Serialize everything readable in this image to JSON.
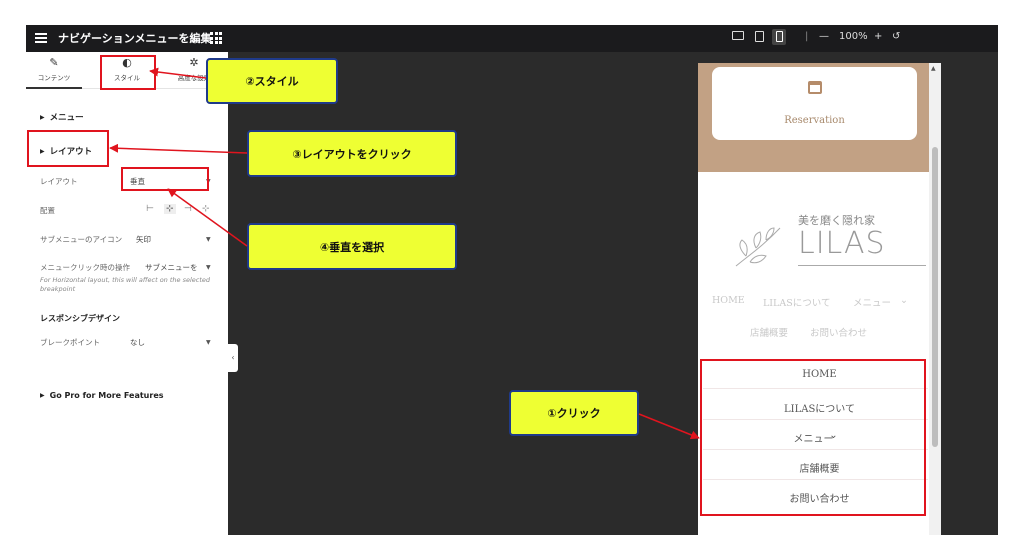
{
  "topbar": {
    "title": "ナビゲーションメニューを編集",
    "zoom": "100%",
    "zoom_minus": "—",
    "zoom_plus": "+",
    "undo": "↺"
  },
  "panel": {
    "tabs": [
      {
        "icon": "✎",
        "label": "コンテンツ"
      },
      {
        "icon": "◐",
        "label": "スタイル"
      },
      {
        "icon": "✲",
        "label": "高度な設定"
      }
    ],
    "menu_section": "メニュー",
    "layout_section": "レイアウト",
    "layout_label": "レイアウト",
    "layout_value": "垂直",
    "align_label": "配置",
    "submenu_icon_label": "サブメニューのアイコン",
    "submenu_icon_value": "矢印",
    "click_action_label": "メニュークリック時の操作",
    "click_action_value": "サブメニューを",
    "note": "For Horizontal layout, this will affect on the selected breakpoint",
    "responsive_heading": "レスポンシブデザイン",
    "breakpoint_label": "ブレークポイント",
    "breakpoint_value": "なし",
    "go_pro": "Go Pro for More Features"
  },
  "preview": {
    "reservation": "Reservation",
    "logo_sub": "美を磨く隠れ家",
    "logo_main": "LILAS",
    "hnav": [
      "HOME",
      "LILASについて",
      "メニュー",
      "店舗概要",
      "お問い合わせ"
    ],
    "vmenu": [
      "HOME",
      "LILASについて",
      "メニュー",
      "店舗概要",
      "お問い合わせ"
    ]
  },
  "callouts": {
    "style": "②スタイル",
    "layout_click": "③レイアウトをクリック",
    "vertical_select": "④垂直を選択",
    "click": "①クリック"
  },
  "colors": {
    "callout_bg": "#eeff33",
    "callout_border": "#1f3a8a",
    "highlight": "#e0141e",
    "banner": "#c2a184"
  }
}
